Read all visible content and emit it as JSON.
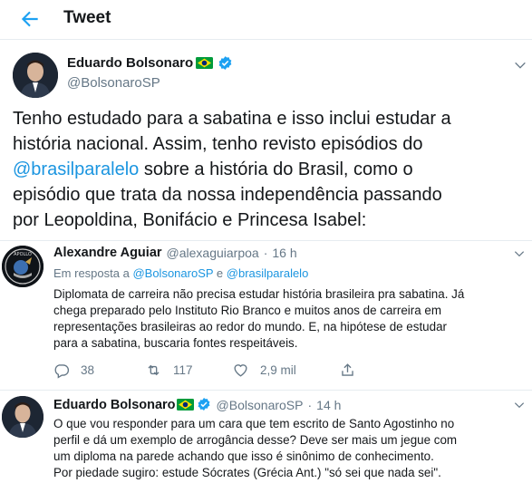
{
  "header": {
    "title": "Tweet"
  },
  "main_tweet": {
    "author_name": "Eduardo Bolsonaro",
    "handle": "@BolsonaroSP",
    "text_lines": [
      {
        "before": "Tenho estudado para a sabatina e isso inclui estudar a",
        "link": "",
        "after": ""
      },
      {
        "before": "história nacional. Assim, tenho revisto episódios do",
        "link": "",
        "after": ""
      },
      {
        "before": "",
        "link": "@brasilparalelo",
        "after": " sobre a história do Brasil, como o"
      },
      {
        "before": "episódio que trata da nossa independência passando",
        "link": "",
        "after": ""
      },
      {
        "before": "por Leopoldina, Bonifácio e Princesa Isabel:",
        "link": "",
        "after": ""
      }
    ]
  },
  "reply_1": {
    "author_name": "Alexandre Aguiar",
    "handle": "@alexaguiarpoa",
    "time": "16 h",
    "in_reply_prefix": "Em resposta a",
    "in_reply_user1": "@BolsonaroSP",
    "in_reply_and": "e",
    "in_reply_user2": "@brasilparalelo",
    "text_lines": [
      "Diplomata de carreira não precisa estudar história brasileira pra sabatina. Já",
      "chega preparado pelo Instituto Rio Branco e muitos anos de carreira em",
      "representações brasileiras ao redor do mundo. E, na hipótese de estudar",
      "para a sabatina, buscaria fontes respeitáveis."
    ],
    "replies_count": "38",
    "retweets_count": "117",
    "likes_count": "2,9 mil"
  },
  "reply_2": {
    "author_name": "Eduardo Bolsonaro",
    "handle": "@BolsonaroSP",
    "time": "14 h",
    "text_lines": [
      "O que vou responder para um cara que tem escrito de Santo Agostinho no",
      "perfil e dá um exemplo de arrogância desse? Deve ser mais um jegue com",
      "um diploma na parede achando que isso é sinônimo de conhecimento.",
      "Por piedade sugiro: estude Sócrates (Grécia Ant.) \"só sei que nada sei\"."
    ]
  },
  "colors": {
    "accent": "#1da1f2",
    "link": "#1b95e0",
    "secondary_text": "#657786",
    "divider": "#e6ecf0",
    "like_count": "#657786"
  },
  "icons": [
    "back-arrow-icon",
    "verified-badge-icon",
    "brazil-flag-icon",
    "caret-down-icon",
    "reply-icon",
    "retweet-icon",
    "like-icon",
    "share-icon"
  ]
}
